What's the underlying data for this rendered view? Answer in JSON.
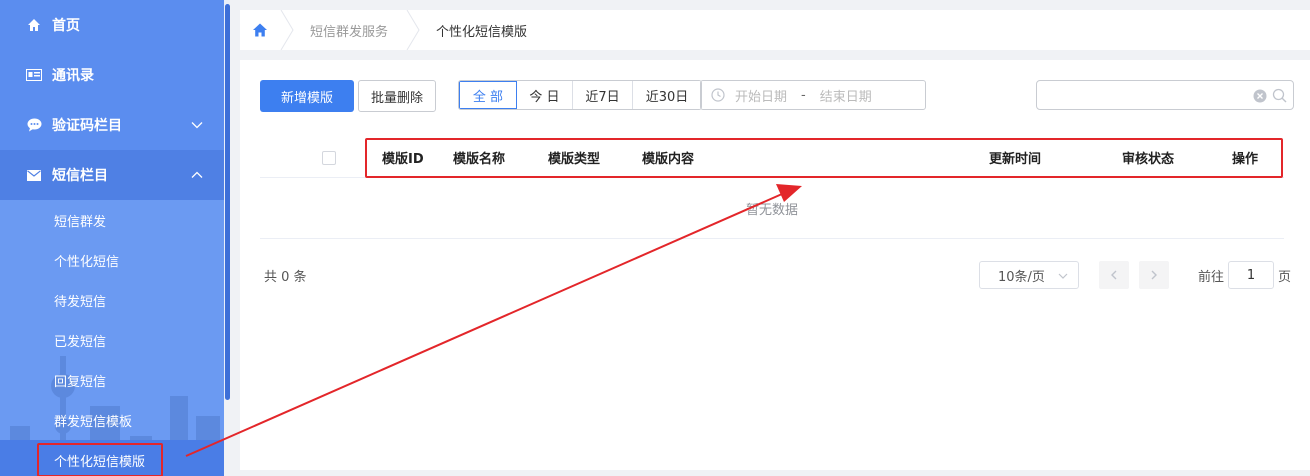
{
  "sidebar": {
    "menu": [
      {
        "label": "首页",
        "icon": "home-icon"
      },
      {
        "label": "通讯录",
        "icon": "contact-card-icon"
      },
      {
        "label": "验证码栏目",
        "icon": "chat-bubble-icon",
        "chevron": "down"
      },
      {
        "label": "短信栏目",
        "icon": "envelope-icon",
        "chevron": "up"
      }
    ],
    "submenu": [
      {
        "label": "短信群发"
      },
      {
        "label": "个性化短信"
      },
      {
        "label": "待发短信"
      },
      {
        "label": "已发短信"
      },
      {
        "label": "回复短信"
      },
      {
        "label": "群发短信模板"
      },
      {
        "label": "个性化短信模版"
      }
    ]
  },
  "breadcrumb": {
    "items": [
      "短信群发服务",
      "个性化短信模版"
    ]
  },
  "toolbar": {
    "add_label": "新增模版",
    "batch_delete_label": "批量删除",
    "range_tabs": [
      "全 部",
      "今 日",
      "近7日",
      "近30日"
    ],
    "start_date_placeholder": "开始日期",
    "range_separator": "-",
    "end_date_placeholder": "结束日期"
  },
  "table": {
    "columns": [
      "模版ID",
      "模版名称",
      "模版类型",
      "模版内容",
      "更新时间",
      "审核状态",
      "操作"
    ],
    "empty_text": "暂无数据"
  },
  "pagination": {
    "total_text": "共 0 条",
    "page_size": "10条/页",
    "goto_prefix": "前往",
    "goto_value": "1",
    "goto_suffix": "页"
  },
  "colors": {
    "sidebar_bg": "#5b8def",
    "primary": "#3d7ff0",
    "annotation_red": "#e3262a"
  }
}
